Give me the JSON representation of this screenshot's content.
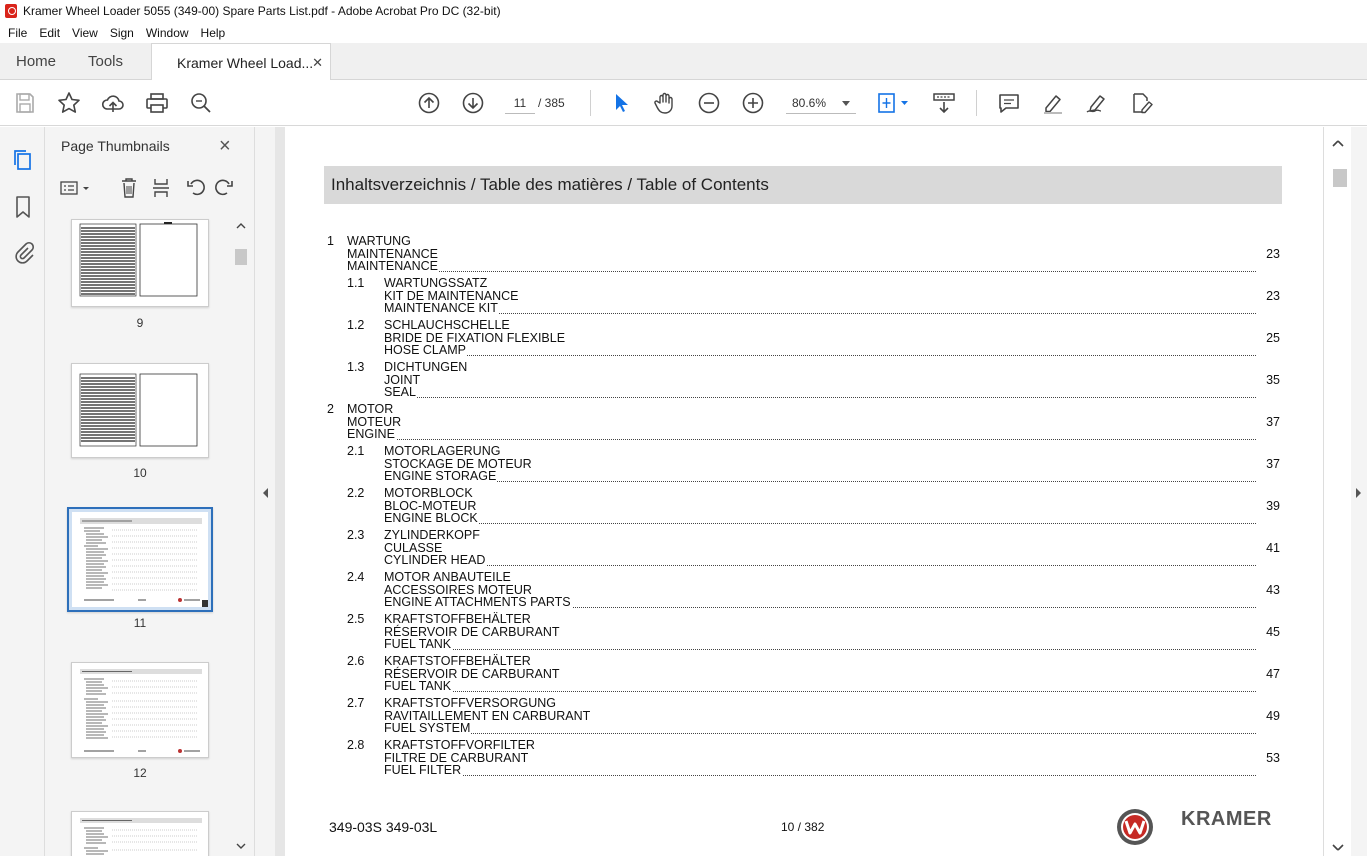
{
  "window": {
    "title": "Kramer Wheel Loader 5055 (349-00) Spare Parts List.pdf - Adobe Acrobat Pro DC (32-bit)"
  },
  "menu": [
    "File",
    "Edit",
    "View",
    "Sign",
    "Window",
    "Help"
  ],
  "tabs": {
    "home": "Home",
    "tools": "Tools",
    "document": "Kramer Wheel Load...",
    "close": "✕"
  },
  "toolbar": {
    "current_page": "11",
    "total_pages": "/  385",
    "zoom": "80.6%"
  },
  "thumbnails_panel": {
    "title": "Page Thumbnails",
    "pages": [
      "9",
      "10",
      "11",
      "12"
    ],
    "selected": "11"
  },
  "document": {
    "toc_title": "Inhaltsverzeichnis / Table des matières / Table of Contents",
    "entries": [
      {
        "num": "1",
        "lines": [
          "WARTUNG",
          "MAINTENANCE",
          "MAINTENANCE"
        ],
        "page": "23",
        "level": 1
      },
      {
        "num": "1.1",
        "lines": [
          "WARTUNGSSATZ",
          "KIT DE MAINTENANCE",
          "MAINTENANCE KIT"
        ],
        "page": "23",
        "level": 2
      },
      {
        "num": "1.2",
        "lines": [
          "SCHLAUCHSCHELLE",
          "BRIDE DE FIXATION FLEXIBLE",
          "HOSE CLAMP"
        ],
        "page": "25",
        "level": 2
      },
      {
        "num": "1.3",
        "lines": [
          "DICHTUNGEN",
          "JOINT",
          "SEAL"
        ],
        "page": "35",
        "level": 2
      },
      {
        "num": "2",
        "lines": [
          "MOTOR",
          "MOTEUR",
          "ENGINE"
        ],
        "page": "37",
        "level": 1
      },
      {
        "num": "2.1",
        "lines": [
          "MOTORLAGERUNG",
          "STOCKAGE DE MOTEUR",
          "ENGINE STORAGE"
        ],
        "page": "37",
        "level": 2
      },
      {
        "num": "2.2",
        "lines": [
          "MOTORBLOCK",
          "BLOC-MOTEUR",
          "ENGINE BLOCK"
        ],
        "page": "39",
        "level": 2
      },
      {
        "num": "2.3",
        "lines": [
          "ZYLINDERKOPF",
          "CULASSE",
          "CYLINDER HEAD"
        ],
        "page": "41",
        "level": 2
      },
      {
        "num": "2.4",
        "lines": [
          "MOTOR ANBAUTEILE",
          "ACCESSOIRES MOTEUR",
          "ENGINE ATTACHMENTS PARTS"
        ],
        "page": "43",
        "level": 2
      },
      {
        "num": "2.5",
        "lines": [
          "KRAFTSTOFFBEHÄLTER",
          "RÉSERVOIR DE CARBURANT",
          "FUEL TANK"
        ],
        "page": "45",
        "level": 2
      },
      {
        "num": "2.6",
        "lines": [
          "KRAFTSTOFFBEHÄLTER",
          "RÉSERVOIR DE CARBURANT",
          "FUEL TANK"
        ],
        "page": "47",
        "level": 2
      },
      {
        "num": "2.7",
        "lines": [
          "KRAFTSTOFFVERSORGUNG",
          "RAVITAILLEMENT EN CARBURANT",
          "FUEL SYSTEM"
        ],
        "page": "49",
        "level": 2
      },
      {
        "num": "2.8",
        "lines": [
          "KRAFTSTOFFVORFILTER",
          "FILTRE DE CARBURANT",
          "FUEL FILTER"
        ],
        "page": "53",
        "level": 2
      }
    ],
    "footer_left": "349-03S   349-03L",
    "footer_page": "10 / 382",
    "brand": "KRAMER"
  },
  "colors": {
    "accent": "#1473e6",
    "toc_header_bg": "#d9d9d9",
    "selected_thumb": "#2d6fba"
  }
}
